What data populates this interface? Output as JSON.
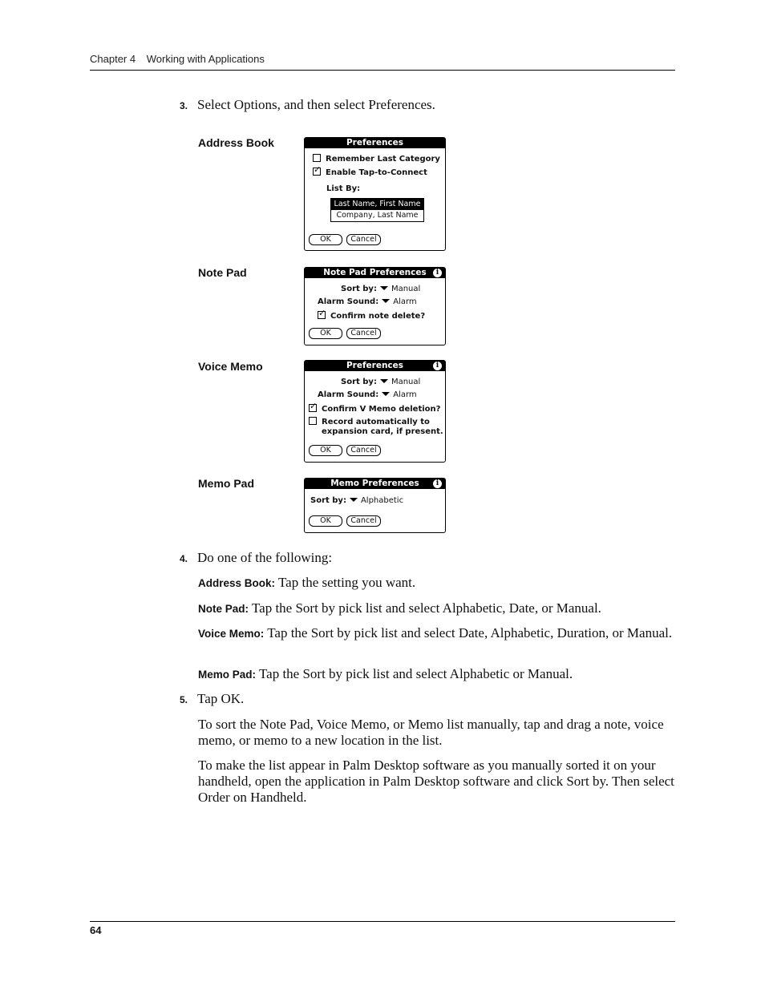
{
  "header": {
    "chapter": "Chapter 4",
    "title": "Working with Applications"
  },
  "steps": {
    "s3": {
      "num": "3.",
      "text": "Select Options, and then select Preferences."
    },
    "s4": {
      "num": "4.",
      "text": "Do one of the following:"
    },
    "s5": {
      "num": "5.",
      "text": "Tap OK."
    }
  },
  "screens": {
    "address_book": {
      "label": "Address Book",
      "title": "Preferences",
      "checkbox1": {
        "label": "Remember Last Category",
        "checked": false
      },
      "checkbox2": {
        "label": "Enable Tap-to-Connect",
        "checked": true
      },
      "list_label": "List By:",
      "list_options": [
        "Last Name, First Name",
        "Company, Last Name"
      ],
      "selected_option": "Last Name, First Name",
      "ok": "OK",
      "cancel": "Cancel"
    },
    "note_pad": {
      "label": "Note Pad",
      "title": "Note Pad Preferences",
      "info_icon": "i",
      "sort_label": "Sort by:",
      "sort_value": "Manual",
      "alarm_label": "Alarm Sound:",
      "alarm_value": "Alarm",
      "confirm": {
        "label": "Confirm note delete?",
        "checked": true
      },
      "ok": "OK",
      "cancel": "Cancel"
    },
    "voice_memo": {
      "label": "Voice Memo",
      "title": "Preferences",
      "info_icon": "i",
      "sort_label": "Sort by:",
      "sort_value": "Manual",
      "alarm_label": "Alarm Sound:",
      "alarm_value": "Alarm",
      "confirm": {
        "label": "Confirm V Memo deletion?",
        "checked": true
      },
      "record": {
        "label_line1": "Record automatically to",
        "label_line2": "expansion card, if present.",
        "checked": false
      },
      "ok": "OK",
      "cancel": "Cancel"
    },
    "memo_pad": {
      "label": "Memo Pad",
      "title": "Memo Preferences",
      "info_icon": "i",
      "sort_label": "Sort by:",
      "sort_value": "Alphabetic",
      "ok": "OK",
      "cancel": "Cancel"
    }
  },
  "instructions": [
    {
      "lead": "Address Book:",
      "text": " Tap the setting you want."
    },
    {
      "lead": "Note Pad:",
      "text": " Tap the Sort by pick list and select Alphabetic, Date, or Manual."
    },
    {
      "lead": "Voice Memo:",
      "text": " Tap the Sort by pick list and select Date, Alphabetic, Duration, or Manual."
    },
    {
      "lead": "Memo Pad:",
      "text": " Tap the Sort by pick list and select Alphabetic or Manual."
    }
  ],
  "paragraphs": [
    "To sort the Note Pad, Voice Memo, or Memo list manually, tap and drag a note, voice memo, or memo to a new location in the list.",
    "To make the list appear in Palm Desktop software as you manually sorted it on your handheld, open the application in Palm Desktop software and click Sort by. Then select Order on Handheld."
  ],
  "footer": {
    "page_number": "64"
  }
}
